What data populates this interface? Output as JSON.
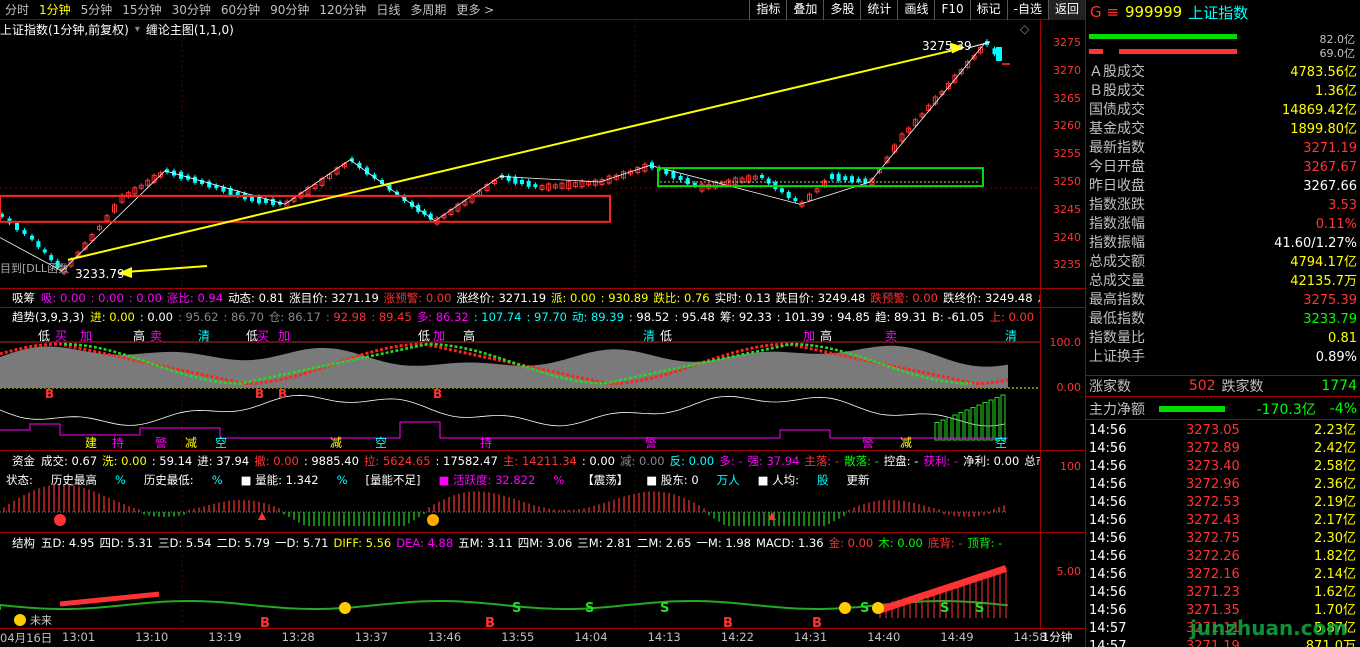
{
  "timeframes": [
    "分时",
    "1分钟",
    "5分钟",
    "15分钟",
    "30分钟",
    "60分钟",
    "90分钟",
    "120分钟",
    "日线",
    "多周期",
    "更多 >"
  ],
  "active_timeframe_index": 1,
  "tools": [
    "指标",
    "叠加",
    "多股",
    "统计",
    "画线",
    "F10",
    "标记",
    "-自选",
    "返回"
  ],
  "chart_title": "上证指数(1分钟,前复权)",
  "overlay_indicator": "缠论主图(1,1,0)",
  "annotations": {
    "high": "3275.39",
    "low": "3233.79",
    "note": "目到[DLL函数"
  },
  "price_axis": [
    "3275",
    "3270",
    "3265",
    "3260",
    "3255",
    "3250",
    "3245",
    "3240",
    "3235"
  ],
  "panel2": {
    "name": "吸筹",
    "line": [
      {
        "t": "吸: 0.00",
        "c": "#ff00ff"
      },
      {
        "t": ": 0.00",
        "c": "#ff00ff"
      },
      {
        "t": ": 0.00",
        "c": "#ff00ff"
      },
      {
        "t": "涨比: 0.94",
        "c": "#ff00ff"
      },
      {
        "t": "动态: 0.81",
        "c": "#fff"
      },
      {
        "t": "涨目价: 3271.19",
        "c": "#fff"
      },
      {
        "t": "涨预警: 0.00",
        "c": "#ff3333"
      },
      {
        "t": "涨终价: 3271.19",
        "c": "#fff"
      },
      {
        "t": "派: 0.00",
        "c": "#ffff00"
      },
      {
        "t": ": 930.89",
        "c": "#ffff00"
      },
      {
        "t": "跌比: 0.76",
        "c": "#ffff00"
      },
      {
        "t": "实时: 0.13",
        "c": "#fff"
      },
      {
        "t": "跌目价: 3249.48",
        "c": "#fff"
      },
      {
        "t": "跌预警: 0.00",
        "c": "#ff3333"
      },
      {
        "t": "跌终价: 3249.48",
        "c": "#fff"
      },
      {
        "t": "总量: 0",
        "c": "#fff"
      }
    ]
  },
  "panel3": {
    "name": "趋势(3,9,3,3)",
    "line": [
      {
        "t": "进: 0.00",
        "c": "#ffff00"
      },
      {
        "t": ": 0.00",
        "c": "#fff"
      },
      {
        "t": ": 95.62",
        "c": "#888"
      },
      {
        "t": ": 86.70",
        "c": "#888"
      },
      {
        "t": "仓: 86.17",
        "c": "#888"
      },
      {
        "t": ": 92.98",
        "c": "#ff3333"
      },
      {
        "t": ": 89.45",
        "c": "#ff3333"
      },
      {
        "t": "多: 86.32",
        "c": "#ff00ff"
      },
      {
        "t": ": 107.74",
        "c": "#00ffff"
      },
      {
        "t": ": 97.70",
        "c": "#00ffff"
      },
      {
        "t": "动: 89.39",
        "c": "#00ffff"
      },
      {
        "t": ": 98.52",
        "c": "#fff"
      },
      {
        "t": ": 95.48",
        "c": "#fff"
      },
      {
        "t": "筹: 92.33",
        "c": "#fff"
      },
      {
        "t": ": 101.39",
        "c": "#fff"
      },
      {
        "t": ": 94.85",
        "c": "#fff"
      },
      {
        "t": "趋: 89.31",
        "c": "#fff"
      },
      {
        "t": "B: -61.05",
        "c": "#fff"
      },
      {
        "t": "上: 0.00",
        "c": "#ff3333"
      },
      {
        "t": "下: 0.00",
        "c": "#00ff00"
      },
      {
        "t": "买",
        "c": "#ff3333"
      }
    ],
    "tags_top": [
      "低",
      "买",
      "加",
      "高",
      "卖",
      "清",
      "低",
      "买",
      "加",
      "低",
      "加",
      "高",
      "清",
      "低",
      "加",
      "高",
      "卖",
      "清"
    ],
    "tags_bottom": [
      "建",
      "持",
      "警",
      "减",
      "空",
      "减",
      "空",
      "持",
      "警",
      "警",
      "减",
      "空"
    ],
    "axis": [
      "100.0",
      "0.00"
    ]
  },
  "panel4": {
    "name": "资金",
    "line": [
      {
        "t": "成交: 0.67",
        "c": "#fff"
      },
      {
        "t": "洗: 0.00",
        "c": "#ffff00"
      },
      {
        "t": ": 59.14",
        "c": "#fff"
      },
      {
        "t": "进: 37.94",
        "c": "#fff"
      },
      {
        "t": "撤: 0.00",
        "c": "#ff3333"
      },
      {
        "t": ": 9885.40",
        "c": "#fff"
      },
      {
        "t": "拉: 5624.65",
        "c": "#ff3333"
      },
      {
        "t": ": 17582.47",
        "c": "#fff"
      },
      {
        "t": "主: 14211.34",
        "c": "#ff3333"
      },
      {
        "t": ": 0.00",
        "c": "#fff"
      },
      {
        "t": "减: 0.00",
        "c": "#888"
      },
      {
        "t": "反: 0.00",
        "c": "#00ffff"
      },
      {
        "t": "多: -",
        "c": "#ff00ff"
      },
      {
        "t": "强: 37.94",
        "c": "#ff00ff"
      },
      {
        "t": "主落: -",
        "c": "#ff3333"
      },
      {
        "t": "散落: -",
        "c": "#00ff00"
      },
      {
        "t": "控盘: -",
        "c": "#fff"
      },
      {
        "t": "获利: -",
        "c": "#ff00ff"
      },
      {
        "t": "净利: 0.00",
        "c": "#fff"
      },
      {
        "t": "总市值: 513",
        "c": "#fff"
      }
    ],
    "line2": [
      {
        "t": "状态:",
        "c": "#fff"
      },
      {
        "t": "历史最高",
        "c": "#fff"
      },
      {
        "t": "%",
        "c": "#00ffff"
      },
      {
        "t": "历史最低:",
        "c": "#fff"
      },
      {
        "t": "%",
        "c": "#00ffff"
      },
      {
        "t": "■ 量能: 1.342",
        "c": "#fff"
      },
      {
        "t": "%",
        "c": "#00ffff"
      },
      {
        "t": "[量能不足]",
        "c": "#fff"
      },
      {
        "t": "■ 活跃度: 32.822",
        "c": "#ff00ff"
      },
      {
        "t": "%",
        "c": "#ff00ff"
      },
      {
        "t": "【震荡】",
        "c": "#fff"
      },
      {
        "t": "■ 股东: 0",
        "c": "#fff"
      },
      {
        "t": "万人",
        "c": "#00ffff"
      },
      {
        "t": "■ 人均:",
        "c": "#fff"
      },
      {
        "t": "股",
        "c": "#00ffff"
      },
      {
        "t": "更新",
        "c": "#fff"
      }
    ],
    "axis": [
      "100"
    ]
  },
  "panel5": {
    "name": "结构",
    "line": [
      {
        "t": "五D: 4.95",
        "c": "#fff"
      },
      {
        "t": "四D: 5.31",
        "c": "#fff"
      },
      {
        "t": "三D: 5.54",
        "c": "#fff"
      },
      {
        "t": "二D: 5.79",
        "c": "#fff"
      },
      {
        "t": "一D: 5.71",
        "c": "#fff"
      },
      {
        "t": "DIFF: 5.56",
        "c": "#ffff00"
      },
      {
        "t": "DEA: 4.88",
        "c": "#ff00ff"
      },
      {
        "t": "五M: 3.11",
        "c": "#fff"
      },
      {
        "t": "四M: 3.06",
        "c": "#fff"
      },
      {
        "t": "三M: 2.81",
        "c": "#fff"
      },
      {
        "t": "二M: 2.65",
        "c": "#fff"
      },
      {
        "t": "一M: 1.98",
        "c": "#fff"
      },
      {
        "t": "MACD: 1.36",
        "c": "#fff"
      },
      {
        "t": "金: 0.00",
        "c": "#ff3333"
      },
      {
        "t": "木: 0.00",
        "c": "#00ff00"
      },
      {
        "t": "底背: -",
        "c": "#ff3333"
      },
      {
        "t": "顶背: -",
        "c": "#00ff00"
      }
    ],
    "axis": [
      "5.00"
    ],
    "note": "未来"
  },
  "x_axis": [
    "04月16日",
    "13:01",
    "13:10",
    "13:19",
    "13:28",
    "13:37",
    "13:46",
    "13:55",
    "14:04",
    "14:13",
    "14:22",
    "14:31",
    "14:40",
    "14:49",
    "14:58"
  ],
  "period_label": "1分钟",
  "right_panel": {
    "code": "999999",
    "name": "上证指数",
    "prefix": "G ≡",
    "bar1": "82.0亿",
    "bar2": "69.0亿",
    "stats": [
      {
        "k": "Ａ股成交",
        "v": "4783.56亿",
        "c": "#ffff00"
      },
      {
        "k": "Ｂ股成交",
        "v": "1.36亿",
        "c": "#ffff00"
      },
      {
        "k": "国债成交",
        "v": "14869.42亿",
        "c": "#ffff00"
      },
      {
        "k": "基金成交",
        "v": "1899.80亿",
        "c": "#ffff00"
      },
      {
        "k": "最新指数",
        "v": "3271.19",
        "c": "#ff3333"
      },
      {
        "k": "今日开盘",
        "v": "3267.67",
        "c": "#ff3333"
      },
      {
        "k": "昨日收盘",
        "v": "3267.66",
        "c": "#ffffff"
      },
      {
        "k": "指数涨跌",
        "v": "3.53",
        "c": "#ff3333"
      },
      {
        "k": "指数涨幅",
        "v": "0.11%",
        "c": "#ff3333"
      },
      {
        "k": "指数振幅",
        "v": "41.60/1.27%",
        "c": "#ffffff"
      },
      {
        "k": "总成交额",
        "v": "4794.17亿",
        "c": "#ffff00"
      },
      {
        "k": "总成交量",
        "v": "42135.7万",
        "c": "#ffff00"
      },
      {
        "k": "最高指数",
        "v": "3275.39",
        "c": "#ff3333"
      },
      {
        "k": "最低指数",
        "v": "3233.79",
        "c": "#00ff00"
      },
      {
        "k": "指数量比",
        "v": "0.81",
        "c": "#ffff00"
      },
      {
        "k": "上证换手",
        "v": "0.89%",
        "c": "#ffffff"
      }
    ],
    "up_label": "涨家数",
    "up_count": "502",
    "down_label": "跌家数",
    "down_count": "1774",
    "net_label": "主力净额",
    "net_value": "-170.3亿",
    "net_pct": "-4%",
    "ticks": [
      {
        "time": "14:56",
        "price": "3273.05",
        "vol": "2.23亿"
      },
      {
        "time": "14:56",
        "price": "3272.89",
        "vol": "2.42亿"
      },
      {
        "time": "14:56",
        "price": "3273.40",
        "vol": "2.58亿"
      },
      {
        "time": "14:56",
        "price": "3272.96",
        "vol": "2.36亿"
      },
      {
        "time": "14:56",
        "price": "3272.53",
        "vol": "2.19亿"
      },
      {
        "time": "14:56",
        "price": "3272.43",
        "vol": "2.17亿"
      },
      {
        "time": "14:56",
        "price": "3272.75",
        "vol": "2.30亿"
      },
      {
        "time": "14:56",
        "price": "3272.26",
        "vol": "1.82亿"
      },
      {
        "time": "14:56",
        "price": "3272.16",
        "vol": "2.14亿"
      },
      {
        "time": "14:56",
        "price": "3271.23",
        "vol": "1.62亿"
      },
      {
        "time": "14:56",
        "price": "3271.35",
        "vol": "1.70亿"
      },
      {
        "time": "14:57",
        "price": "3271.11",
        "vol": "5.87亿"
      },
      {
        "time": "14:57",
        "price": "3271.19",
        "vol": "871.0万"
      }
    ],
    "watermark": "junzhuan.com"
  }
}
